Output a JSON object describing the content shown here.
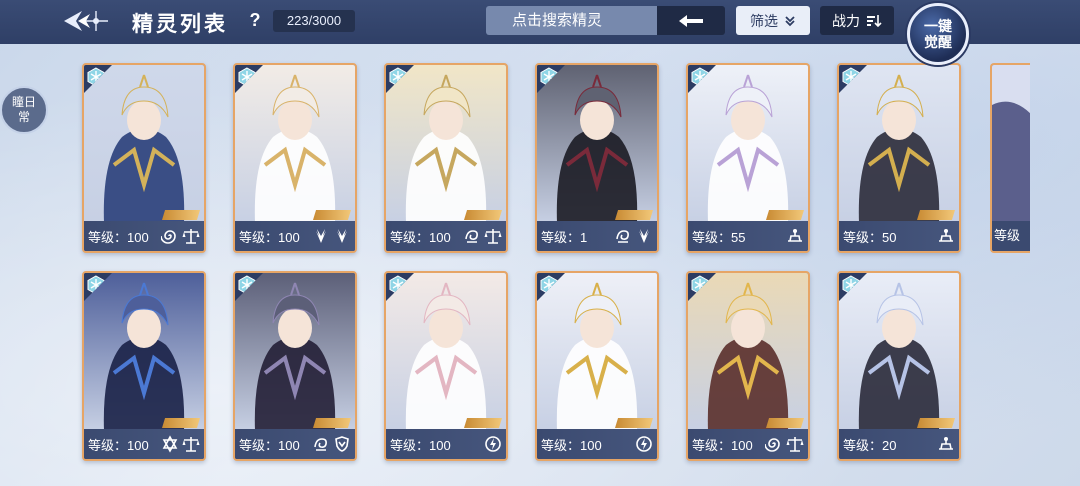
{
  "header": {
    "title": "精灵列表",
    "help": "?",
    "count": "223/3000",
    "search_placeholder": "点击搜索精灵",
    "filter_label": "筛选",
    "sort_label": "战力",
    "awaken_line1": "一键",
    "awaken_line2": "觉醒"
  },
  "side_tab": {
    "label": "瞳日常"
  },
  "colors": {
    "card_border": "#e6a566",
    "topbar": "#34466e",
    "element_badge": "#8fd5e6"
  },
  "cards": [
    {
      "level": "等级：100",
      "traits": [
        "spiral-icon",
        "scale-icon"
      ],
      "palette": [
        "#cfd8ea",
        "#2a3f7a",
        "#d4b25a"
      ]
    },
    {
      "level": "等级：100",
      "traits": [
        "wing-icon",
        "wing-icon"
      ],
      "palette": [
        "#f2ece6",
        "#ffffff",
        "#d9b36a"
      ]
    },
    {
      "level": "等级：100",
      "traits": [
        "swirl-icon",
        "scale-icon"
      ],
      "palette": [
        "#f1e6c7",
        "#ffffff",
        "#c6a75e"
      ]
    },
    {
      "level": "等级：1",
      "traits": [
        "swirl-icon",
        "wing-icon"
      ],
      "palette": [
        "#5f6272",
        "#1b1b24",
        "#7a2a3a"
      ]
    },
    {
      "level": "等级：55",
      "traits": [
        "wisdom-icon"
      ],
      "palette": [
        "#eef1f8",
        "#ffffff",
        "#b9a2d6"
      ]
    },
    {
      "level": "等级：50",
      "traits": [
        "wisdom-icon"
      ],
      "palette": [
        "#dfe5f2",
        "#2b2b3a",
        "#d4af4f"
      ]
    },
    {
      "level": "等级：100",
      "traits": [
        "star-icon",
        "scale-icon"
      ],
      "palette": [
        "#4e5f9a",
        "#1a2147",
        "#4b79d4"
      ]
    },
    {
      "level": "等级：100",
      "traits": [
        "swirl-icon",
        "shield-icon"
      ],
      "palette": [
        "#5c5f78",
        "#231f36",
        "#8f86b3"
      ]
    },
    {
      "level": "等级：100",
      "traits": [
        "lightning-icon"
      ],
      "palette": [
        "#f3eae6",
        "#ffffff",
        "#e3b6c2"
      ]
    },
    {
      "level": "等级：100",
      "traits": [
        "lightning-icon"
      ],
      "palette": [
        "#eef0f7",
        "#ffffff",
        "#d8b04a"
      ]
    },
    {
      "level": "等级：100",
      "traits": [
        "spiral-icon",
        "scale-icon"
      ],
      "palette": [
        "#ead9b6",
        "#5a2f2b",
        "#e2b64d"
      ]
    },
    {
      "level": "等级：20",
      "traits": [
        "wisdom-icon"
      ],
      "palette": [
        "#e9edf7",
        "#2a2a3a",
        "#b6c3e6"
      ]
    }
  ],
  "partial_card": {
    "level": "等级"
  }
}
